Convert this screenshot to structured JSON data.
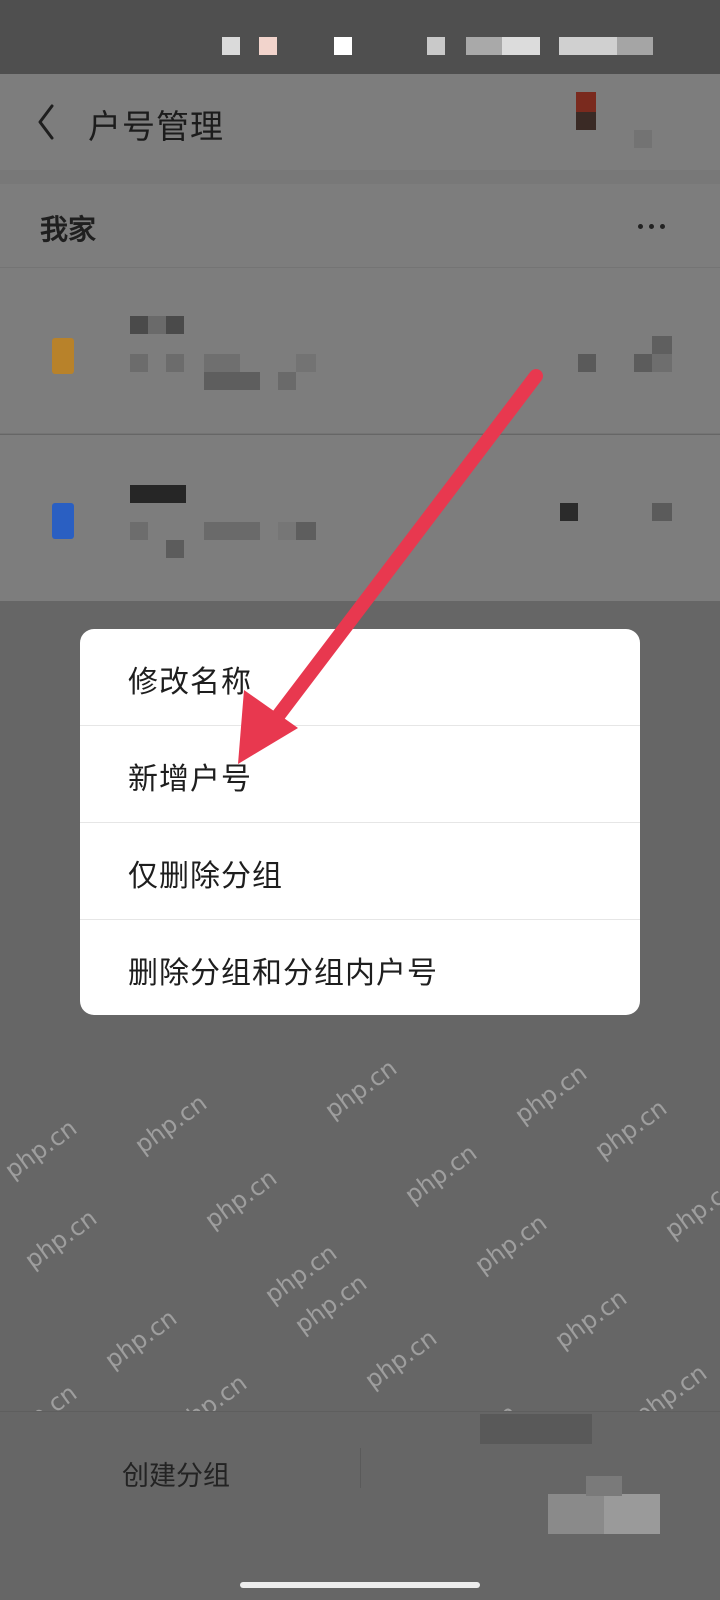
{
  "header": {
    "title": "户号管理"
  },
  "group": {
    "name": "我家"
  },
  "menu": {
    "items": [
      {
        "label": "修改名称"
      },
      {
        "label": "新增户号"
      },
      {
        "label": "仅删除分组"
      },
      {
        "label": "删除分组和分组内户号"
      }
    ]
  },
  "bottom_bar": {
    "create_group_label": "创建分组"
  },
  "watermark": {
    "text": "php.cn"
  },
  "colors": {
    "arrow": "#e8384f",
    "overlay": "#666666",
    "popup_bg": "#ffffff",
    "account_icon_1": "#b8822a",
    "account_icon_2": "#2a5fc2"
  },
  "icons": {
    "back": "chevron-left-icon",
    "more": "more-horizontal-icon"
  }
}
